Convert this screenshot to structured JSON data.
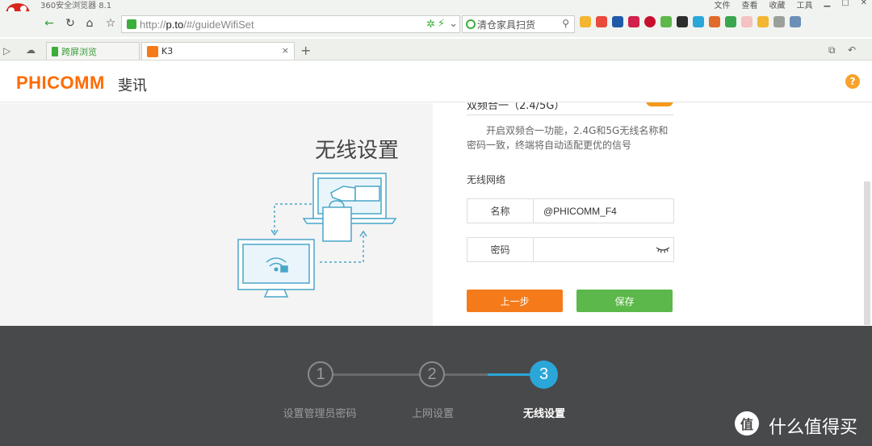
{
  "browser": {
    "title": "360安全浏览器 8.1",
    "menu": [
      "文件",
      "查看",
      "收藏",
      "工具"
    ],
    "url_prefix": "http://",
    "url_host": "p.to",
    "url_path": "/#/guideWifiSet",
    "search_placeholder": "清仓家具扫货",
    "tabs": [
      {
        "label": "跨屏浏览"
      },
      {
        "label": "K3"
      }
    ],
    "tab_close": "×",
    "tab_new": "+"
  },
  "header": {
    "brand": "PHICOMM",
    "brand_cn": "斐讯",
    "help": "?"
  },
  "left": {
    "title": "无线设置"
  },
  "form": {
    "dual_band_label": "双频合一（2.4/5G）",
    "dual_band_on": true,
    "dual_band_desc": "开启双频合一功能，2.4G和5G无线名称和密码一致，终端将自动适配更优的信号",
    "network_label": "无线网络",
    "name_label": "名称",
    "name_value": "@PHICOMM_F4",
    "password_label": "密码",
    "password_value": "",
    "prev_button": "上一步",
    "save_button": "保存"
  },
  "steps": [
    {
      "num": "1",
      "label": "设置管理员密码"
    },
    {
      "num": "2",
      "label": "上网设置"
    },
    {
      "num": "3",
      "label": "无线设置"
    }
  ],
  "active_step": 3,
  "watermark": {
    "icon": "值",
    "text": "什么值得买"
  },
  "colors": {
    "brand": "#ff6b00",
    "prev": "#f57b1a",
    "save": "#5cb84a",
    "step_active": "#2ba6d9"
  }
}
